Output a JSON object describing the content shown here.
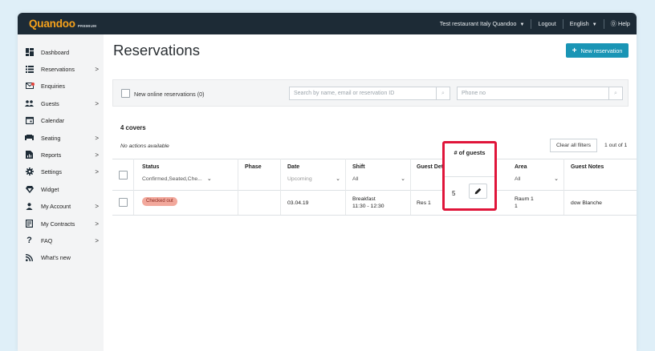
{
  "topbar": {
    "brand": "Quandoo",
    "brand_sub": "PREMIUM",
    "restaurant": "Test restaurant Italy Quandoo",
    "logout": "Logout",
    "language": "English",
    "help": "Help"
  },
  "sidebar": {
    "items": [
      {
        "label": "Dashboard",
        "icon": "dashboard-icon",
        "chevron": ""
      },
      {
        "label": "Reservations",
        "icon": "list-icon",
        "chevron": ">"
      },
      {
        "label": "Enquiries",
        "icon": "mail-icon",
        "chevron": ""
      },
      {
        "label": "Guests",
        "icon": "people-icon",
        "chevron": ">"
      },
      {
        "label": "Calendar",
        "icon": "calendar-icon",
        "chevron": ""
      },
      {
        "label": "Seating",
        "icon": "sofa-icon",
        "chevron": ">"
      },
      {
        "label": "Reports",
        "icon": "report-icon",
        "chevron": ">"
      },
      {
        "label": "Settings",
        "icon": "gear-icon",
        "chevron": ">"
      },
      {
        "label": "Widget",
        "icon": "diamond-icon",
        "chevron": ""
      },
      {
        "label": "My Account",
        "icon": "user-icon",
        "chevron": ">"
      },
      {
        "label": "My Contracts",
        "icon": "contract-icon",
        "chevron": ">"
      },
      {
        "label": "FAQ",
        "icon": "question-icon",
        "chevron": ">"
      },
      {
        "label": "What's new",
        "icon": "rss-icon",
        "chevron": ""
      }
    ]
  },
  "main": {
    "title": "Reservations",
    "new_reservation": "New reservation",
    "filter": {
      "online_label": "New online reservations (0)",
      "search_placeholder": "Search by name, email or reservation ID",
      "phone_placeholder": "Phone no"
    },
    "covers": "4 covers",
    "no_actions": "No actions available",
    "clear_filters": "Clear all filters",
    "pager": "1 out of 1",
    "table": {
      "headers": {
        "status": "Status",
        "status_filter": "Confirmed,Seated,Che...",
        "phase": "Phase",
        "date": "Date",
        "date_filter": "Upcoming",
        "shift": "Shift",
        "shift_filter": "All",
        "guest_details": "Guest Details",
        "guests": "# of guests",
        "area": "Area",
        "area_filter": "All",
        "guest_notes": "Guest Notes"
      },
      "rows": [
        {
          "status": "Checked out",
          "phase": "",
          "date": "03.04.19",
          "shift_name": "Breakfast",
          "shift_time": "11:30 - 12:30",
          "guest_details": "Res 1",
          "guests": "5",
          "area": "Raum 1",
          "area_sub": "1",
          "guest_notes": "dow Blanche"
        }
      ]
    }
  },
  "colors": {
    "topbar": "#1d2b36",
    "brand": "#f7a21b",
    "accent": "#1a95b5",
    "badge": "#f2a89c",
    "highlight": "#e0153a"
  }
}
